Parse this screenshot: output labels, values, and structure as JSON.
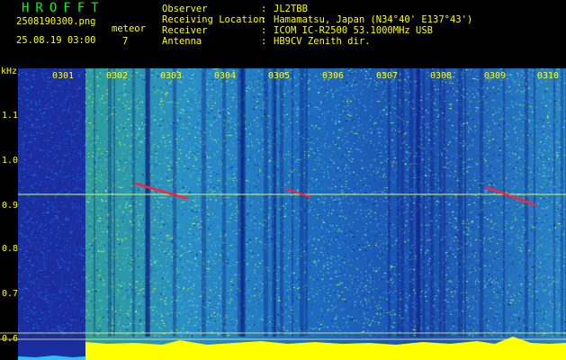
{
  "header": {
    "app_title": "HROFFT",
    "filename": "2508190300.png",
    "datetime": "25.08.19 03:00",
    "meteor_label": "meteor",
    "meteor_count": "7",
    "info": [
      {
        "key": "Observer",
        "value": "JL2TBB"
      },
      {
        "key": "Receiving Location",
        "value": "Hamamatsu, Japan (N34°40' E137°43')"
      },
      {
        "key": "Receiver",
        "value": "ICOM IC-R2500 53.1000MHz USB"
      },
      {
        "key": "Antenna",
        "value": "HB9CV Zenith dir."
      }
    ]
  },
  "spectrogram": {
    "unit": "kHz",
    "y_ticks": [
      "1.1",
      "1.0",
      "0.9",
      "0.8",
      "0.7",
      "0.6"
    ],
    "time_labels": [
      "0301",
      "0302",
      "0303",
      "0304",
      "0305",
      "0306",
      "0307",
      "0308",
      "0309",
      "0310"
    ]
  },
  "colors": {
    "header_text": "#ffff00",
    "title_text": "#00ff00",
    "background": "#000000",
    "noise_deep": "#1a2a9a",
    "noise_mid": "#1f7fc8",
    "noise_high": "#39d0a0",
    "meteor_trace": "#ff2040",
    "carrier_line": "#d8ff60"
  }
}
